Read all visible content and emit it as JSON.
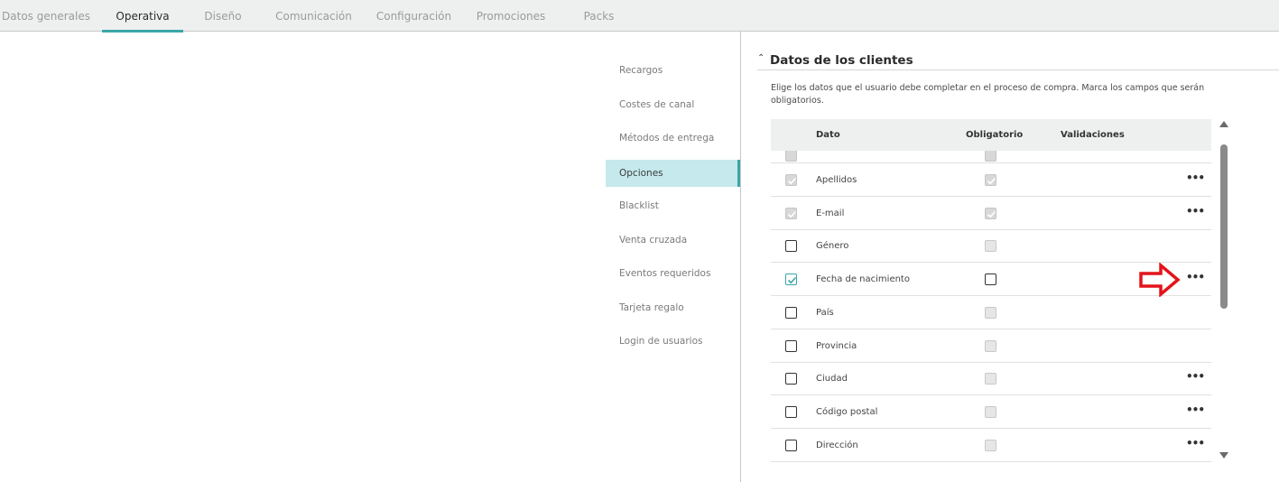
{
  "tabs": [
    {
      "label": "Datos generales",
      "active": false
    },
    {
      "label": "Operativa",
      "active": true
    },
    {
      "label": "Diseño",
      "active": false
    },
    {
      "label": "Comunicación",
      "active": false
    },
    {
      "label": "Configuración",
      "active": false
    },
    {
      "label": "Promociones",
      "active": false
    },
    {
      "label": "Packs",
      "active": false
    }
  ],
  "submenu": {
    "items": [
      {
        "label": "Recargos"
      },
      {
        "label": "Costes de canal"
      },
      {
        "label": "Métodos de entrega"
      },
      {
        "label": "Opciones",
        "active": true
      },
      {
        "label": "Blacklist"
      },
      {
        "label": "Venta cruzada"
      },
      {
        "label": "Eventos requeridos"
      },
      {
        "label": "Tarjeta regalo"
      },
      {
        "label": "Login de usuarios"
      }
    ]
  },
  "section": {
    "title": "Datos de los clientes",
    "description": "Elige los datos que el usuario debe completar en el proceso de compra. Marca los campos que serán obligatorios."
  },
  "table": {
    "headers": {
      "dato": "Dato",
      "obligatorio": "Obligatorio",
      "validaciones": "Validaciones"
    },
    "rows": [
      {
        "label": "Apellidos",
        "selected": "checked-disabled",
        "required": "checked-disabled",
        "more": "•••"
      },
      {
        "label": "E-mail",
        "selected": "checked-disabled",
        "required": "checked-disabled",
        "more": "•••"
      },
      {
        "label": "Género",
        "selected": "unchecked",
        "required": "disabled",
        "more": ""
      },
      {
        "label": "Fecha de nacimiento",
        "selected": "checked",
        "required": "unchecked",
        "more": "•••"
      },
      {
        "label": "País",
        "selected": "unchecked",
        "required": "disabled",
        "more": ""
      },
      {
        "label": "Provincia",
        "selected": "unchecked",
        "required": "disabled",
        "more": ""
      },
      {
        "label": "Ciudad",
        "selected": "unchecked",
        "required": "disabled",
        "more": "•••"
      },
      {
        "label": "Código postal",
        "selected": "unchecked",
        "required": "disabled",
        "more": "•••"
      },
      {
        "label": "Dirección",
        "selected": "unchecked",
        "required": "disabled",
        "more": "•••"
      }
    ]
  },
  "colors": {
    "accent": "#3aa6a7",
    "submenu_active_bg": "#c5e9ec",
    "annotation_arrow": "#e3141b"
  },
  "icons": {
    "section_chevron": "chevron-up-icon",
    "more": "more-horizontal-icon",
    "annotation": "red-arrow-right-icon"
  }
}
